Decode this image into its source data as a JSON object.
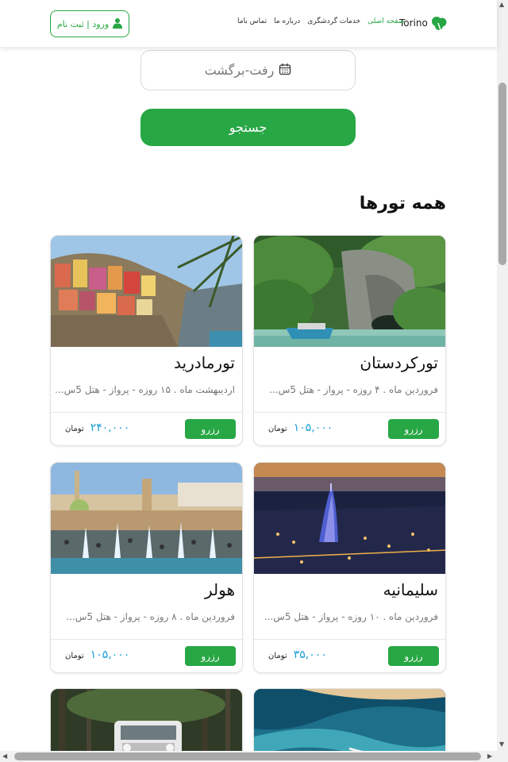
{
  "header": {
    "logo_text": "Torino",
    "nav": [
      {
        "label": "صفحه اصلی",
        "active": true
      },
      {
        "label": "خدمات گردشگری",
        "active": false
      },
      {
        "label": "درباره ما",
        "active": false
      },
      {
        "label": "تماس باما",
        "active": false
      }
    ],
    "login_label": "ورود | ثبت نام"
  },
  "search": {
    "date_placeholder": "رفت-برگشت",
    "button_label": "جستجو"
  },
  "section_title": "همه تورها",
  "currency_label": "تومان",
  "reserve_label": "رزرو",
  "tours": [
    {
      "title": "تورکردستان",
      "desc": "فروردین ماه . ۴ روزه - پرواز - هتل 5س...",
      "price": "۱۰۵,۰۰۰",
      "image": "cave-boat-image"
    },
    {
      "title": "تورمادرید",
      "desc": "اردیبهشت ماه . ۱۵ روزه - پرواز - هتل 5س...",
      "price": "۲۴۰,۰۰۰",
      "image": "coastal-village-image"
    },
    {
      "title": "سلیمانیه",
      "desc": "فروردین ماه . ۱۰ روزه - پرواز - هتل 5س...",
      "price": "۳۵,۰۰۰",
      "image": "night-city-image"
    },
    {
      "title": "هولر",
      "desc": "فروردین ماه . ۸ روزه - پرواز - هتل 5س...",
      "price": "۱۰۵,۰۰۰",
      "image": "fountain-square-image"
    },
    {
      "title": "",
      "desc": "",
      "price": "",
      "image": "beach-aerial-image"
    },
    {
      "title": "",
      "desc": "",
      "price": "",
      "image": "forest-jeep-image"
    }
  ],
  "colors": {
    "accent": "#28a745",
    "price": "#1a9fd4"
  }
}
